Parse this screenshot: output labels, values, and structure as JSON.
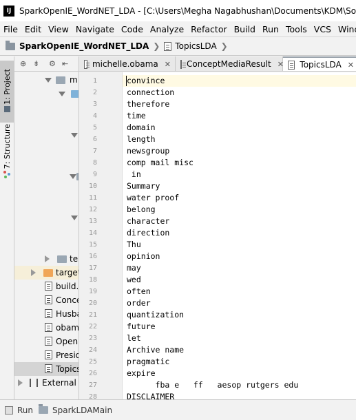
{
  "window": {
    "title": "SparkOpenIE_WordNET_LDA - [C:\\Users\\Megha Nagabhushan\\Documents\\KDM\\Source-code",
    "logo_text": "IJ"
  },
  "menu": [
    "File",
    "Edit",
    "View",
    "Navigate",
    "Code",
    "Analyze",
    "Refactor",
    "Build",
    "Run",
    "Tools",
    "VCS",
    "Window"
  ],
  "breadcrumb": {
    "project": "SparkOpenIE_WordNET_LDA",
    "file": "TopicsLDA"
  },
  "toolstrip": {
    "project_tab": "1: Project",
    "structure_tab": "7: Structure"
  },
  "tree": {
    "items": [
      {
        "label": "m"
      },
      {
        "label": "te"
      },
      {
        "label": "target"
      },
      {
        "label": "build.s"
      },
      {
        "label": "Conce"
      },
      {
        "label": "Husba"
      },
      {
        "label": "obam"
      },
      {
        "label": "OpenI"
      },
      {
        "label": "Presid"
      },
      {
        "label": "Topics"
      },
      {
        "label": "External Li"
      }
    ]
  },
  "tabs": [
    {
      "label": "michelle.obama"
    },
    {
      "label": "ConceptMediaResult"
    },
    {
      "label": "TopicsLDA"
    }
  ],
  "editor": {
    "lines": [
      {
        "num": "1",
        "text": "convince"
      },
      {
        "num": "2",
        "text": "connection"
      },
      {
        "num": "3",
        "text": "therefore"
      },
      {
        "num": "4",
        "text": "time"
      },
      {
        "num": "5",
        "text": "domain"
      },
      {
        "num": "6",
        "text": "length"
      },
      {
        "num": "7",
        "text": "newsgroup"
      },
      {
        "num": "8",
        "text": "comp mail misc"
      },
      {
        "num": "9",
        "text": " in"
      },
      {
        "num": "10",
        "text": "Summary"
      },
      {
        "num": "11",
        "text": "water proof"
      },
      {
        "num": "12",
        "text": "belong"
      },
      {
        "num": "13",
        "text": "character"
      },
      {
        "num": "14",
        "text": "direction"
      },
      {
        "num": "15",
        "text": "Thu"
      },
      {
        "num": "16",
        "text": "opinion"
      },
      {
        "num": "17",
        "text": "may"
      },
      {
        "num": "18",
        "text": "wed"
      },
      {
        "num": "19",
        "text": "often"
      },
      {
        "num": "20",
        "text": "order"
      },
      {
        "num": "21",
        "text": "quantization"
      },
      {
        "num": "22",
        "text": "future"
      },
      {
        "num": "23",
        "text": "let"
      },
      {
        "num": "24",
        "text": "Archive name"
      },
      {
        "num": "25",
        "text": "pragmatic"
      },
      {
        "num": "26",
        "text": "expire"
      },
      {
        "num": "27",
        "text": "      fba e   ff   aesop rutgers edu"
      },
      {
        "num": "28",
        "text": "DISCLAIMER"
      }
    ]
  },
  "bottom": {
    "run_label": "Run",
    "config_label": "SparkLDAMain"
  },
  "colors": {
    "caret_line": "#fffae3",
    "gutter": "#f0f0f0",
    "selection": "#d4d4d4"
  }
}
